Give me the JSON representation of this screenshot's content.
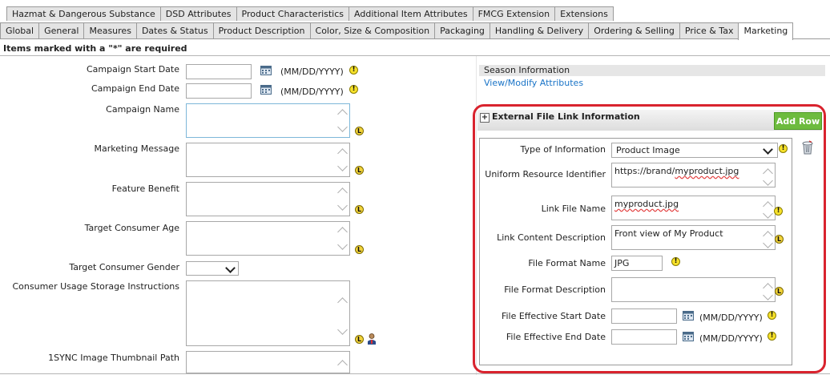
{
  "tabs_row1": [
    "Hazmat & Dangerous Substance",
    "DSD Attributes",
    "Product Characteristics",
    "Additional Item Attributes",
    "FMCG Extension",
    "Extensions"
  ],
  "tabs_row2": [
    "Global",
    "General",
    "Measures",
    "Dates & Status",
    "Product Description",
    "Color, Size & Composition",
    "Packaging",
    "Handling & Delivery",
    "Ordering & Selling",
    "Price & Tax",
    "Marketing"
  ],
  "active_tab": "Marketing",
  "required_note": "Items marked with a \"*\" are required",
  "date_format": "(MM/DD/YYYY)",
  "left_form": {
    "campaign_start_date": "Campaign Start Date",
    "campaign_end_date": "Campaign End Date",
    "campaign_name": "Campaign Name",
    "marketing_message": "Marketing Message",
    "feature_benefit": "Feature Benefit",
    "target_consumer_age": "Target Consumer Age",
    "target_consumer_gender": "Target Consumer Gender",
    "consumer_usage": "Consumer Usage Storage Instructions",
    "thumbnail_path": "1SYNC Image Thumbnail Path"
  },
  "season": {
    "header": "Season Information",
    "link": "View/Modify Attributes"
  },
  "external": {
    "title": "External File Link Information",
    "add_row": "Add Row",
    "labels": {
      "type_of_information": "Type of Information",
      "uri": "Uniform Resource Identifier",
      "link_file_name": "Link File Name",
      "link_content_description": "Link Content Description",
      "file_format_name": "File Format Name",
      "file_format_description": "File Format Description",
      "file_effective_start_date": "File Effective Start Date",
      "file_effective_end_date": "File Effective End Date"
    },
    "values": {
      "type_of_information": "Product Image",
      "uri_prefix": "https://brand/",
      "uri_suffix": "myproduct.jpg",
      "link_file_name": "myproduct.jpg",
      "link_content_description": "Front view of My Product",
      "file_format_name": "JPG"
    }
  },
  "icons": {
    "info": "!",
    "lock": "L"
  },
  "colors": {
    "highlight_border": "#d9232e",
    "add_row_bg": "#6dbb3e",
    "link": "#1a74c7"
  }
}
